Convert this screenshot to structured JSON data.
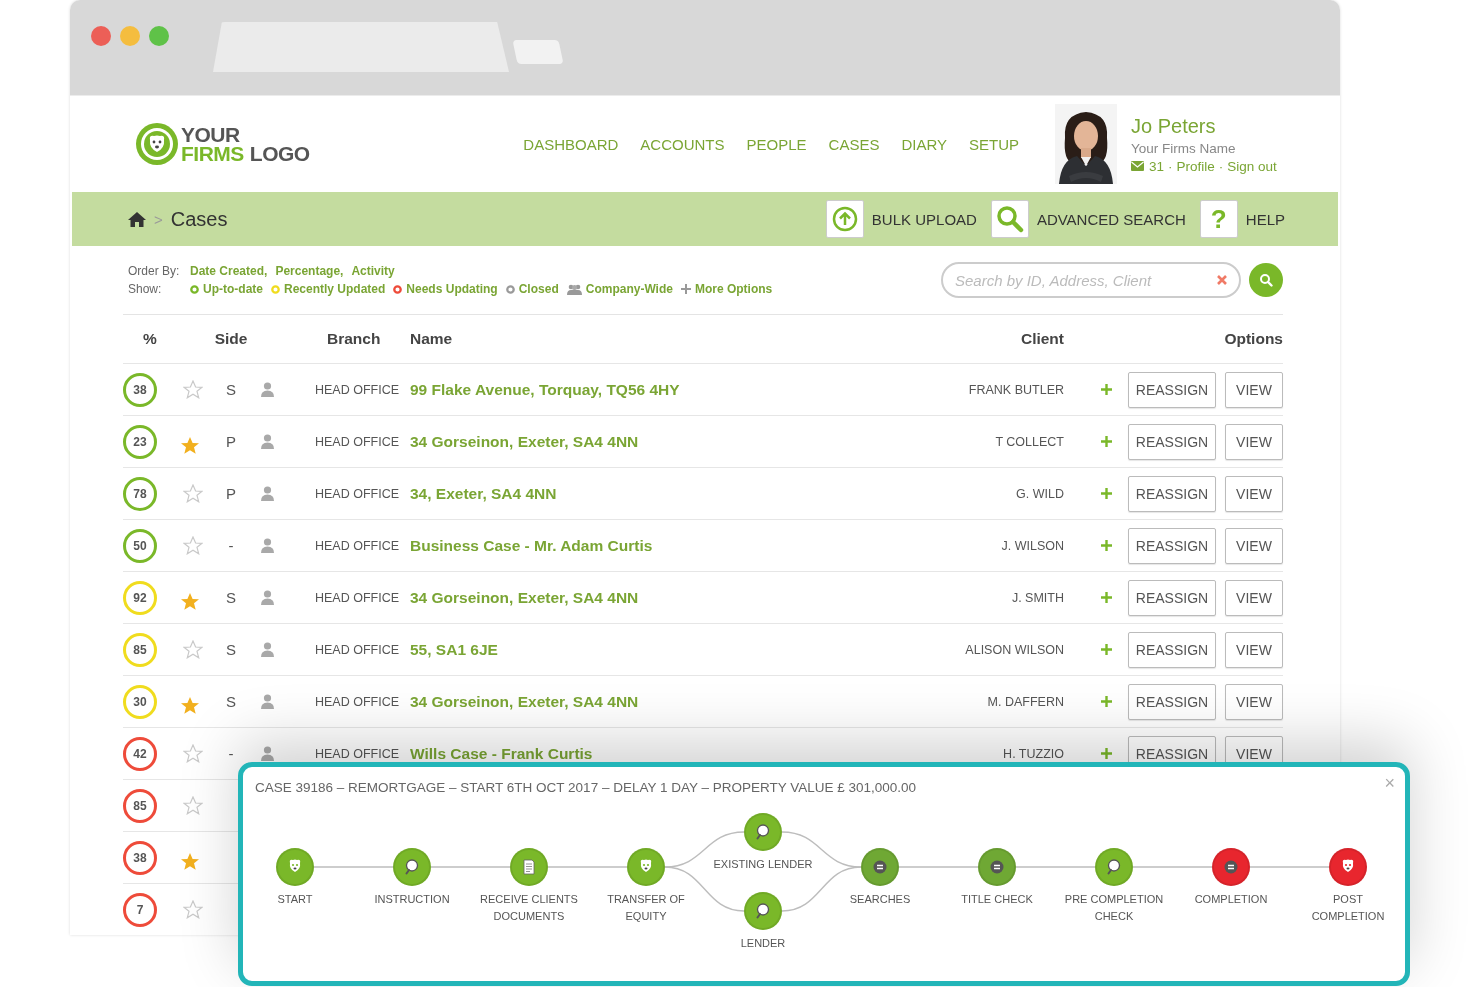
{
  "logo": {
    "line1": "YOUR",
    "line2_accent": "FIRMS",
    "line2": "LOGO"
  },
  "nav": [
    "DASHBOARD",
    "ACCOUNTS",
    "PEOPLE",
    "CASES",
    "DIARY",
    "SETUP"
  ],
  "user": {
    "name": "Jo Peters",
    "firm": "Your Firms Name",
    "messages": "31",
    "separator": "·",
    "links": [
      "Profile",
      "Sign out"
    ]
  },
  "breadcrumb": {
    "separator": ">",
    "current": "Cases"
  },
  "toolbar": [
    {
      "kind": "upload",
      "label": "BULK UPLOAD"
    },
    {
      "kind": "search",
      "label": "ADVANCED SEARCH"
    },
    {
      "kind": "help",
      "glyph": "?",
      "label": "HELP"
    }
  ],
  "order_by": {
    "label": "Order By:",
    "options": [
      "Date Created,",
      "Percentage,",
      "Activity"
    ]
  },
  "show": {
    "label": "Show:",
    "filters": [
      {
        "kind": "dot",
        "color": "#7ab829",
        "label": "Up-to-date"
      },
      {
        "kind": "dot",
        "color": "#f0dc1e",
        "label": "Recently Updated"
      },
      {
        "kind": "dot",
        "color": "#ee4b3a",
        "label": "Needs Updating"
      },
      {
        "kind": "dot",
        "color": "#9a9a9a",
        "label": "Closed"
      },
      {
        "kind": "people",
        "label": "Company-Wide"
      },
      {
        "kind": "plus",
        "label": "More Options"
      }
    ]
  },
  "search": {
    "placeholder": "Search by ID, Address, Client"
  },
  "table": {
    "columns": [
      "%",
      "Side",
      "Branch",
      "Name",
      "Client",
      "Options"
    ],
    "rows": [
      {
        "percent": "38",
        "color": "#7ab829",
        "starred": false,
        "side": "S",
        "branch": "HEAD OFFICE",
        "name": "99 Flake Avenue, Torquay, TQ56 4HY",
        "client": "FRANK BUTLER",
        "buttons": [
          "REASSIGN",
          "VIEW"
        ]
      },
      {
        "percent": "23",
        "color": "#7ab829",
        "starred": true,
        "side": "P",
        "branch": "HEAD OFFICE",
        "name": "34 Gorseinon, Exeter, SA4 4NN",
        "client": "T COLLECT",
        "buttons": [
          "REASSIGN",
          "VIEW"
        ]
      },
      {
        "percent": "78",
        "color": "#7ab829",
        "starred": false,
        "side": "P",
        "branch": "HEAD OFFICE",
        "name": "34, Exeter, SA4 4NN",
        "client": "G. WILD",
        "buttons": [
          "REASSIGN",
          "VIEW"
        ]
      },
      {
        "percent": "50",
        "color": "#7ab829",
        "starred": false,
        "side": "-",
        "branch": "HEAD OFFICE",
        "name": "Business Case - Mr. Adam Curtis",
        "client": "J. WILSON",
        "buttons": [
          "REASSIGN",
          "VIEW"
        ]
      },
      {
        "percent": "92",
        "color": "#f0dc1e",
        "starred": true,
        "side": "S",
        "branch": "HEAD OFFICE",
        "name": "34 Gorseinon, Exeter, SA4 4NN",
        "client": "J. SMITH",
        "buttons": [
          "REASSIGN",
          "VIEW"
        ]
      },
      {
        "percent": "85",
        "color": "#f0dc1e",
        "starred": false,
        "side": "S",
        "branch": "HEAD OFFICE",
        "name": "55, SA1 6JE",
        "client": "ALISON WILSON",
        "buttons": [
          "REASSIGN",
          "VIEW"
        ]
      },
      {
        "percent": "30",
        "color": "#f0dc1e",
        "starred": true,
        "side": "S",
        "branch": "HEAD OFFICE",
        "name": "34 Gorseinon, Exeter, SA4 4NN",
        "client": "M. DAFFERN",
        "buttons": [
          "REASSIGN",
          "VIEW"
        ]
      },
      {
        "percent": "42",
        "color": "#ee4b3a",
        "starred": false,
        "side": "-",
        "branch": "HEAD OFFICE",
        "name": "Wills Case - Frank Curtis",
        "client": "H. TUZZIO",
        "buttons": [
          "REASSIGN",
          "VIEW"
        ]
      },
      {
        "percent": "85",
        "color": "#ee4b3a",
        "starred": false
      },
      {
        "percent": "38",
        "color": "#ee4b3a",
        "starred": true
      },
      {
        "percent": "7",
        "color": "#ee4b3a",
        "starred": false
      }
    ]
  },
  "case_popup": {
    "title": "CASE 39186 – REMORTGAGE – START 6TH OCT 2017 – DELAY 1 DAY – PROPERTY VALUE £ 301,000.00",
    "close": "×",
    "stages": [
      {
        "kind": "dog",
        "label": "START",
        "color": "#7ab829"
      },
      {
        "kind": "magnifier",
        "label": "INSTRUCTION",
        "color": "#7ab829"
      },
      {
        "kind": "document",
        "label": "RECEIVE CLIENTS DOCUMENTS",
        "color": "#7ab829"
      },
      {
        "kind": "dog",
        "label": "TRANSFER OF EQUITY",
        "color": "#7ab829"
      },
      {
        "kind": "split",
        "branches": [
          {
            "kind": "magnifier",
            "label": "EXISTING LENDER",
            "color": "#7ab829"
          },
          {
            "kind": "magnifier",
            "label": "LENDER",
            "color": "#7ab829"
          }
        ]
      },
      {
        "kind": "coin",
        "label": "SEARCHES",
        "color": "#6fa834"
      },
      {
        "kind": "coin",
        "label": "TITLE CHECK",
        "color": "#6fa834"
      },
      {
        "kind": "magnifier",
        "label": "PRE COMPLETION CHECK",
        "color": "#7ab829"
      },
      {
        "kind": "coin",
        "label": "COMPLETION",
        "color": "#e8262e"
      },
      {
        "kind": "dog",
        "label": "POST COMPLETION",
        "color": "#e8262e"
      }
    ]
  }
}
